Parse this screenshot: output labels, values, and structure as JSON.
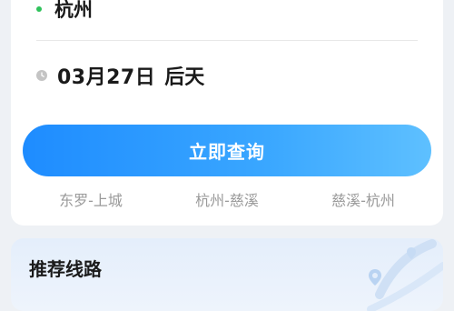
{
  "search": {
    "destination": "杭州",
    "date": "03月27日",
    "date_label": "后天",
    "query_button": "立即查询"
  },
  "history": [
    "东罗-上城",
    "杭州-慈溪",
    "慈溪-杭州"
  ],
  "recommend": {
    "title": "推荐线路"
  },
  "colors": {
    "accent": "#1e8cff",
    "dot": "#2fc25b"
  }
}
